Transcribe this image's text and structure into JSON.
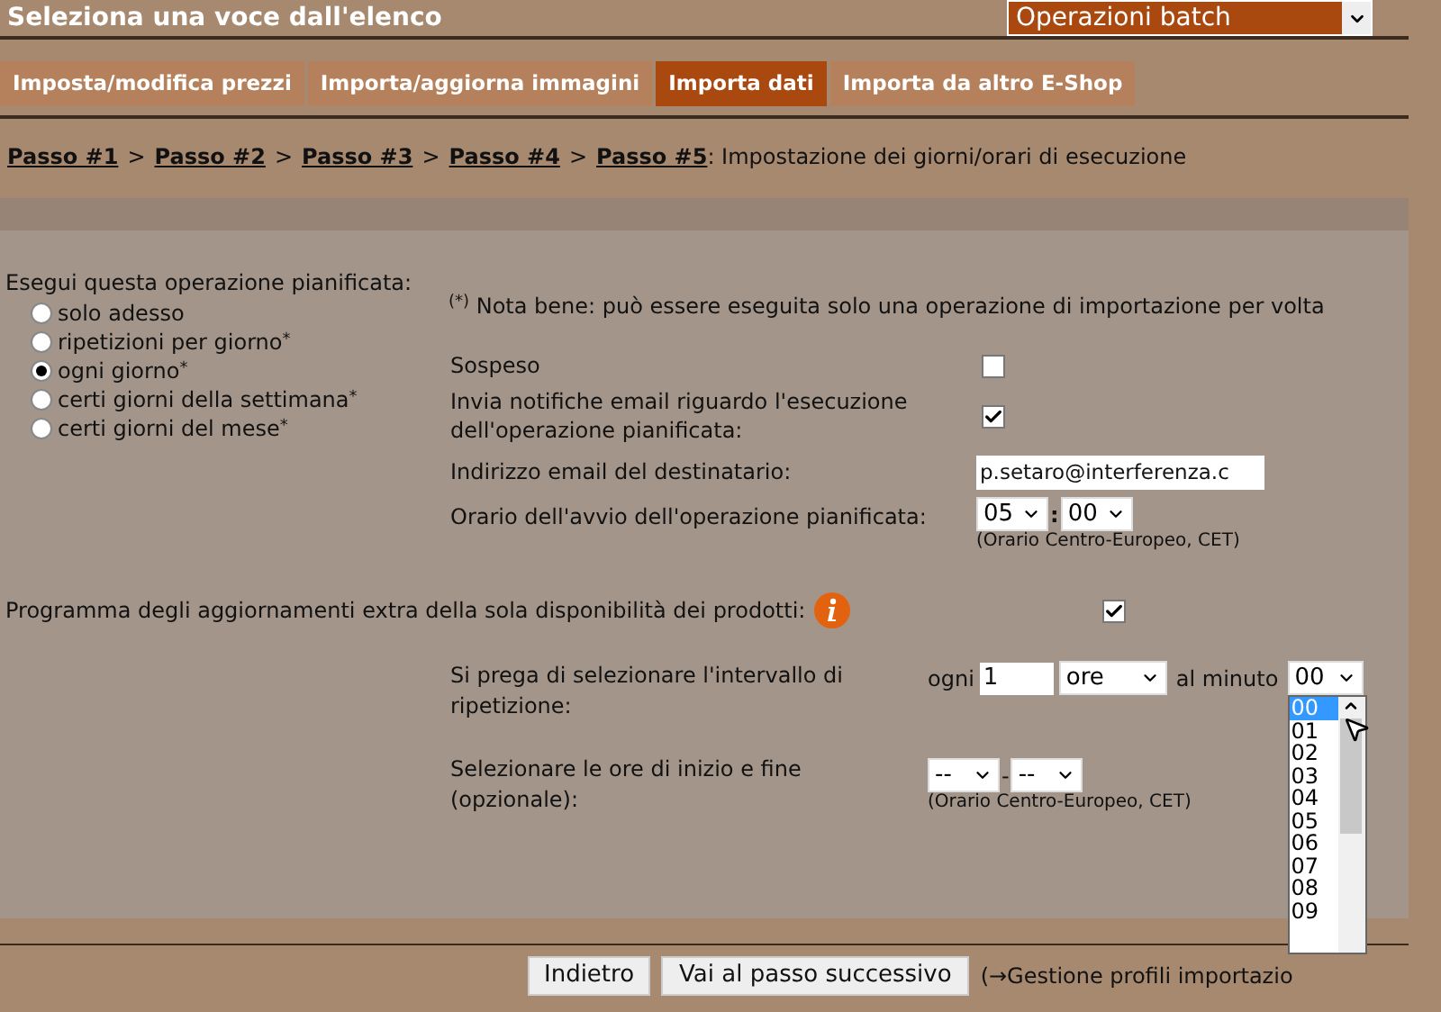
{
  "header": {
    "title": "Seleziona una voce dall'elenco",
    "select_value": "Operazioni batch"
  },
  "tabs": [
    {
      "label": "Imposta/modifica prezzi",
      "selected": false
    },
    {
      "label": "Importa/aggiorna immagini",
      "selected": false
    },
    {
      "label": "Importa dati",
      "selected": true
    },
    {
      "label": "Importa da altro E-Shop",
      "selected": false
    }
  ],
  "breadcrumb": {
    "steps": [
      "Passo #1",
      "Passo #2",
      "Passo #3",
      "Passo #4",
      "Passo #5"
    ],
    "separator": ">",
    "current": ": Impostazione dei giorni/orari di esecuzione"
  },
  "schedule": {
    "label": "Esegui questa operazione pianificata:",
    "options": [
      {
        "label": "solo adesso",
        "selected": false
      },
      {
        "label": "ripetizioni per giorno$^{*}$",
        "selected": false
      },
      {
        "label": "ogni giorno$^{*}$",
        "selected": true
      },
      {
        "label": "certi giorni della settimana$^{*}$",
        "selected": false
      },
      {
        "label": "certi giorni del mese$^{*}$",
        "selected": false
      }
    ]
  },
  "note": "$^{(*)}$ Nota bene: può essere eseguita solo una operazione di importazione per volta",
  "settings": {
    "suspended": {
      "label": "Sospeso",
      "checked": false
    },
    "notify": {
      "label": "Invia notifiche email riguardo l'esecuzione dell'operazione pianificata:",
      "checked": true
    },
    "email": {
      "label": "Indirizzo email del destinatario:",
      "value": "p.setaro@interferenza.c"
    },
    "start_time": {
      "label": "Orario dell'avvio dell'operazione pianificata:",
      "hour": "05",
      "separator": ":",
      "minute": "00",
      "note": "(Orario Centro-Europeo, CET)"
    }
  },
  "extra": {
    "label": "Programma degli aggiornamenti extra della sola disponibilità dei prodotti:",
    "checked": true,
    "interval": {
      "label": "Si prega di selezionare l'intervallo di ripetizione:",
      "every_label": "ogni",
      "every_value": "1",
      "unit": "ore",
      "minute_label": "al minuto",
      "minute_value": "00",
      "dropdown": [
        {
          "label": "00",
          "selected": true
        },
        {
          "label": "01",
          "selected": false
        },
        {
          "label": "02",
          "selected": false
        },
        {
          "label": "03",
          "selected": false
        },
        {
          "label": "04",
          "selected": false
        },
        {
          "label": "05",
          "selected": false
        },
        {
          "label": "06",
          "selected": false
        },
        {
          "label": "07",
          "selected": false
        },
        {
          "label": "08",
          "selected": false
        },
        {
          "label": "09",
          "selected": false
        }
      ]
    },
    "range": {
      "label": "Selezionare le ore di inizio e fine (opzionale):",
      "start": "--",
      "separator": "-",
      "end": "--",
      "note": "(Orario Centro-Europeo, CET)"
    }
  },
  "footer": {
    "buttons": [
      "Indietro",
      "Vai al passo successivo"
    ],
    "link": "(→Gestione profili importazio"
  }
}
